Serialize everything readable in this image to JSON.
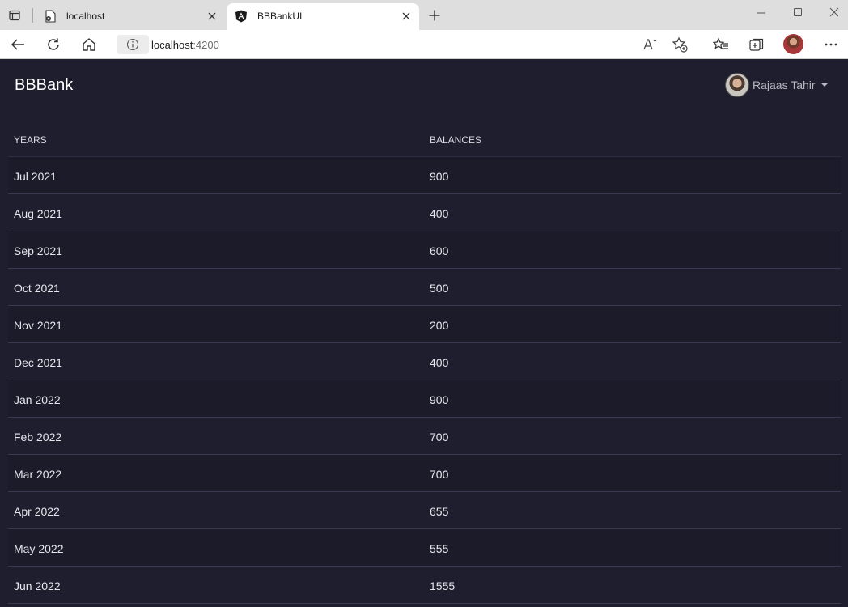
{
  "browser": {
    "tabs": [
      {
        "title": "localhost",
        "favicon": "page-error-icon",
        "active": false
      },
      {
        "title": "BBBankUI",
        "favicon": "angular-icon",
        "active": true
      }
    ],
    "address": {
      "host": "localhost",
      "port": ":4200"
    },
    "toolbar_icons": [
      "back-icon",
      "refresh-icon",
      "home-icon",
      "read-aloud-icon",
      "add-favorite-icon",
      "favorites-icon",
      "collections-icon",
      "profile-avatar",
      "more-icon"
    ]
  },
  "app": {
    "brand": "BBBank",
    "user": {
      "name": "Rajaas Tahir"
    },
    "table": {
      "headers": {
        "years": "YEARS",
        "balances": "BALANCES"
      },
      "rows": [
        {
          "year": "Jul 2021",
          "balance": "900"
        },
        {
          "year": "Aug 2021",
          "balance": "400"
        },
        {
          "year": "Sep 2021",
          "balance": "600"
        },
        {
          "year": "Oct 2021",
          "balance": "500"
        },
        {
          "year": "Nov 2021",
          "balance": "200"
        },
        {
          "year": "Dec 2021",
          "balance": "400"
        },
        {
          "year": "Jan 2022",
          "balance": "900"
        },
        {
          "year": "Feb 2022",
          "balance": "700"
        },
        {
          "year": "Mar 2022",
          "balance": "700"
        },
        {
          "year": "Apr 2022",
          "balance": "655"
        },
        {
          "year": "May 2022",
          "balance": "555"
        },
        {
          "year": "Jun 2022",
          "balance": "1555"
        }
      ]
    }
  },
  "colors": {
    "background": "#1f1e2e",
    "text": "#e6e6ec",
    "row_border": "#3a3950"
  }
}
